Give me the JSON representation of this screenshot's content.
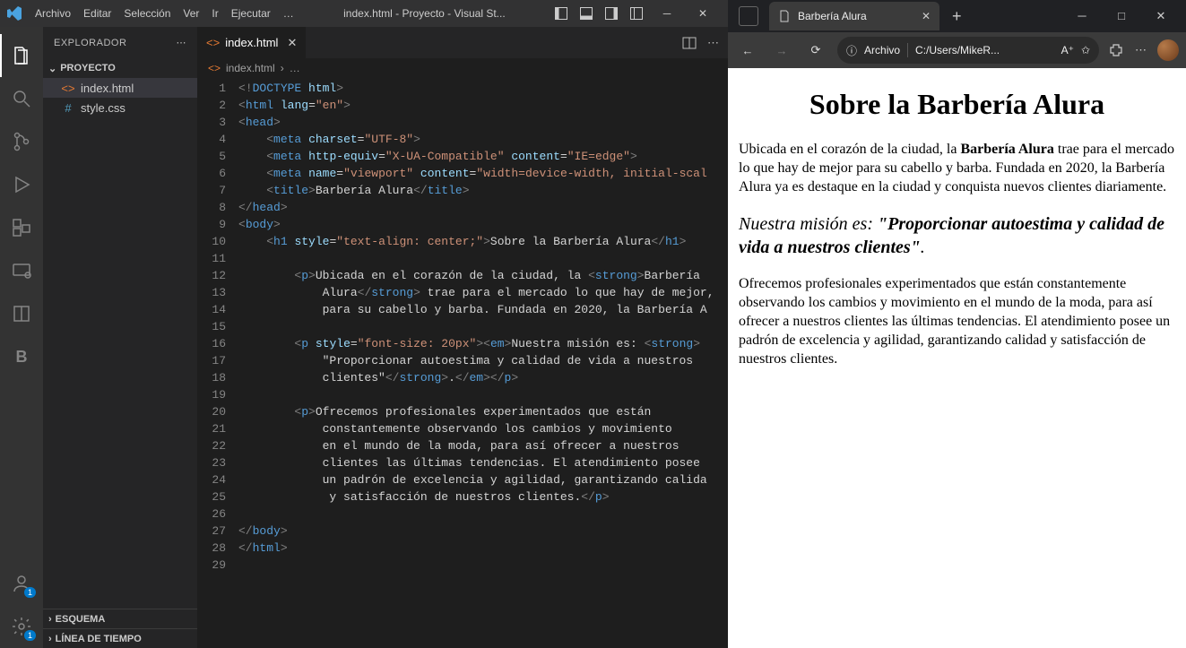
{
  "vscode": {
    "menu": [
      "Archivo",
      "Editar",
      "Selección",
      "Ver",
      "Ir",
      "Ejecutar",
      "…"
    ],
    "window_title": "index.html - Proyecto - Visual St...",
    "activity": {
      "items": [
        "files-icon",
        "search-icon",
        "scm-icon",
        "debug-icon",
        "extensions-icon",
        "remote-icon",
        "book-icon",
        "bold-icon"
      ],
      "bottom": [
        "account-icon",
        "gear-icon"
      ],
      "badges": {
        "account-icon": "1",
        "gear-icon": "1"
      }
    },
    "sidebar": {
      "header": "EXPLORADOR",
      "project": "PROYECTO",
      "files": [
        {
          "name": "index.html",
          "icon": "html-icon",
          "active": true
        },
        {
          "name": "style.css",
          "icon": "css-icon",
          "active": false
        }
      ],
      "bottom_sections": [
        "ESQUEMA",
        "LÍNEA DE TIEMPO"
      ]
    },
    "editor": {
      "tab": {
        "name": "index.html",
        "icon": "html-icon"
      },
      "breadcrumb": [
        "index.html",
        "…"
      ],
      "line_count": 29,
      "code": {
        "l1": {
          "indent": 0,
          "tokens": [
            [
              "brk",
              "<!"
            ],
            [
              "doctype",
              "DOCTYPE"
            ],
            [
              "txt",
              " "
            ],
            [
              "attr",
              "html"
            ],
            [
              "brk",
              ">"
            ]
          ]
        },
        "l2": {
          "indent": 0,
          "tokens": [
            [
              "brk",
              "<"
            ],
            [
              "tag",
              "html"
            ],
            [
              "txt",
              " "
            ],
            [
              "attr",
              "lang"
            ],
            [
              "txt",
              "="
            ],
            [
              "str",
              "\"en\""
            ],
            [
              "brk",
              ">"
            ]
          ]
        },
        "l3": {
          "indent": 0,
          "tokens": [
            [
              "brk",
              "<"
            ],
            [
              "tag",
              "head"
            ],
            [
              "brk",
              ">"
            ]
          ]
        },
        "l4": {
          "indent": 1,
          "tokens": [
            [
              "brk",
              "<"
            ],
            [
              "tag",
              "meta"
            ],
            [
              "txt",
              " "
            ],
            [
              "attr",
              "charset"
            ],
            [
              "txt",
              "="
            ],
            [
              "str",
              "\"UTF-8\""
            ],
            [
              "brk",
              ">"
            ]
          ]
        },
        "l5": {
          "indent": 1,
          "tokens": [
            [
              "brk",
              "<"
            ],
            [
              "tag",
              "meta"
            ],
            [
              "txt",
              " "
            ],
            [
              "attr",
              "http-equiv"
            ],
            [
              "txt",
              "="
            ],
            [
              "str",
              "\"X-UA-Compatible\""
            ],
            [
              "txt",
              " "
            ],
            [
              "attr",
              "content"
            ],
            [
              "txt",
              "="
            ],
            [
              "str",
              "\"IE=edge\""
            ],
            [
              "brk",
              ">"
            ]
          ]
        },
        "l6": {
          "indent": 1,
          "tokens": [
            [
              "brk",
              "<"
            ],
            [
              "tag",
              "meta"
            ],
            [
              "txt",
              " "
            ],
            [
              "attr",
              "name"
            ],
            [
              "txt",
              "="
            ],
            [
              "str",
              "\"viewport\""
            ],
            [
              "txt",
              " "
            ],
            [
              "attr",
              "content"
            ],
            [
              "txt",
              "="
            ],
            [
              "str",
              "\"width=device-width, initial-scal"
            ]
          ]
        },
        "l7": {
          "indent": 1,
          "tokens": [
            [
              "brk",
              "<"
            ],
            [
              "tag",
              "title"
            ],
            [
              "brk",
              ">"
            ],
            [
              "txt",
              "Barbería Alura"
            ],
            [
              "brk",
              "</"
            ],
            [
              "tag",
              "title"
            ],
            [
              "brk",
              ">"
            ]
          ]
        },
        "l8": {
          "indent": 0,
          "tokens": [
            [
              "brk",
              "</"
            ],
            [
              "tag",
              "head"
            ],
            [
              "brk",
              ">"
            ]
          ]
        },
        "l9": {
          "indent": 0,
          "tokens": [
            [
              "brk",
              "<"
            ],
            [
              "tag",
              "body"
            ],
            [
              "brk",
              ">"
            ]
          ]
        },
        "l10": {
          "indent": 1,
          "tokens": [
            [
              "brk",
              "<"
            ],
            [
              "tag",
              "h1"
            ],
            [
              "txt",
              " "
            ],
            [
              "attr",
              "style"
            ],
            [
              "txt",
              "="
            ],
            [
              "str",
              "\"text-align: center;\""
            ],
            [
              "brk",
              ">"
            ],
            [
              "txt",
              "Sobre la Barbería Alura"
            ],
            [
              "brk",
              "</"
            ],
            [
              "tag",
              "h1"
            ],
            [
              "brk",
              ">"
            ]
          ]
        },
        "l11": {
          "indent": 0,
          "tokens": []
        },
        "l12": {
          "indent": 2,
          "tokens": [
            [
              "brk",
              "<"
            ],
            [
              "tag",
              "p"
            ],
            [
              "brk",
              ">"
            ],
            [
              "txt",
              "Ubicada en el corazón de la ciudad, la "
            ],
            [
              "brk",
              "<"
            ],
            [
              "tag",
              "strong"
            ],
            [
              "brk",
              ">"
            ],
            [
              "txt",
              "Barbería"
            ]
          ]
        },
        "l13": {
          "indent": 3,
          "tokens": [
            [
              "txt",
              "Alura"
            ],
            [
              "brk",
              "</"
            ],
            [
              "tag",
              "strong"
            ],
            [
              "brk",
              ">"
            ],
            [
              "txt",
              " trae para el mercado lo que hay de mejor,"
            ]
          ]
        },
        "l14": {
          "indent": 3,
          "tokens": [
            [
              "txt",
              "para su cabello y barba. Fundada en 2020, la Barbería A"
            ]
          ]
        },
        "l15": {
          "indent": 0,
          "tokens": []
        },
        "l16": {
          "indent": 2,
          "tokens": [
            [
              "brk",
              "<"
            ],
            [
              "tag",
              "p"
            ],
            [
              "txt",
              " "
            ],
            [
              "attr",
              "style"
            ],
            [
              "txt",
              "="
            ],
            [
              "str",
              "\"font-size: 20px\""
            ],
            [
              "brk",
              ">"
            ],
            [
              "brk",
              "<"
            ],
            [
              "tag",
              "em"
            ],
            [
              "brk",
              ">"
            ],
            [
              "txt",
              "Nuestra misión es: "
            ],
            [
              "brk",
              "<"
            ],
            [
              "tag",
              "strong"
            ],
            [
              "brk",
              ">"
            ]
          ]
        },
        "l17": {
          "indent": 3,
          "tokens": [
            [
              "txt",
              "\"Proporcionar autoestima y calidad de vida a nuestros"
            ]
          ]
        },
        "l18": {
          "indent": 3,
          "tokens": [
            [
              "txt",
              "clientes\""
            ],
            [
              "brk",
              "</"
            ],
            [
              "tag",
              "strong"
            ],
            [
              "brk",
              ">"
            ],
            [
              "txt",
              "."
            ],
            [
              "brk",
              "</"
            ],
            [
              "tag",
              "em"
            ],
            [
              "brk",
              ">"
            ],
            [
              "brk",
              "</"
            ],
            [
              "tag",
              "p"
            ],
            [
              "brk",
              ">"
            ]
          ]
        },
        "l19": {
          "indent": 0,
          "tokens": []
        },
        "l20": {
          "indent": 2,
          "tokens": [
            [
              "brk",
              "<"
            ],
            [
              "tag",
              "p"
            ],
            [
              "brk",
              ">"
            ],
            [
              "txt",
              "Ofrecemos profesionales experimentados que están"
            ]
          ]
        },
        "l21": {
          "indent": 3,
          "tokens": [
            [
              "txt",
              "constantemente observando los cambios y movimiento"
            ]
          ]
        },
        "l22": {
          "indent": 3,
          "tokens": [
            [
              "txt",
              "en el mundo de la moda, para así ofrecer a nuestros"
            ]
          ]
        },
        "l23": {
          "indent": 3,
          "tokens": [
            [
              "txt",
              "clientes las últimas tendencias. El atendimiento posee"
            ]
          ]
        },
        "l24": {
          "indent": 3,
          "tokens": [
            [
              "txt",
              "un padrón de excelencia y agilidad, garantizando calida"
            ]
          ]
        },
        "l25": {
          "indent": 3,
          "tokens": [
            [
              "txt",
              " y satisfacción de nuestros clientes."
            ],
            [
              "brk",
              "</"
            ],
            [
              "tag",
              "p"
            ],
            [
              "brk",
              ">"
            ]
          ]
        },
        "l26": {
          "indent": 0,
          "tokens": []
        },
        "l27": {
          "indent": 0,
          "tokens": [
            [
              "brk",
              "</"
            ],
            [
              "tag",
              "body"
            ],
            [
              "brk",
              ">"
            ]
          ]
        },
        "l28": {
          "indent": 0,
          "tokens": [
            [
              "brk",
              "</"
            ],
            [
              "tag",
              "html"
            ],
            [
              "brk",
              ">"
            ]
          ]
        },
        "l29": {
          "indent": 0,
          "tokens": []
        }
      }
    }
  },
  "browser": {
    "tab_title": "Barbería Alura",
    "url_scheme": "Archivo",
    "url_path": "C:/Users/MikeR...",
    "page": {
      "heading": "Sobre la Barbería Alura",
      "p1_a": "Ubicada en el corazón de la ciudad, la ",
      "p1_strong": "Barbería Alura",
      "p1_b": " trae para el mercado lo que hay de mejor para su cabello y barba. Fundada en 2020, la Barbería Alura ya es destaque en la ciudad y conquista nuevos clientes diariamente.",
      "p2_a": "Nuestra misión es: ",
      "p2_strong": "\"Proporcionar autoestima y calidad de vida a nuestros clientes\"",
      "p2_b": ".",
      "p3": "Ofrecemos profesionales experimentados que están constantemente observando los cambios y movimiento en el mundo de la moda, para así ofrecer a nuestros clientes las últimas tendencias. El atendimiento posee un padrón de excelencia y agilidad, garantizando calidad y satisfacción de nuestros clientes."
    }
  }
}
